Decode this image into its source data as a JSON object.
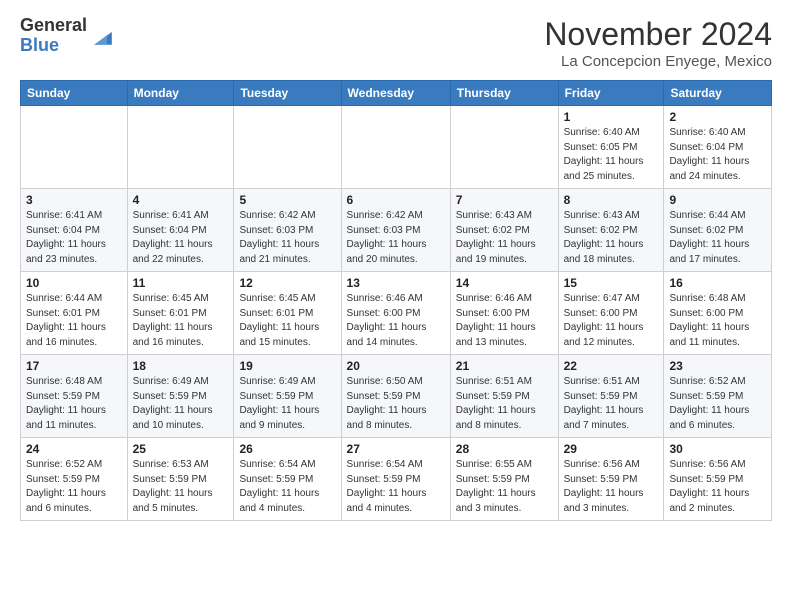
{
  "logo": {
    "general": "General",
    "blue": "Blue"
  },
  "header": {
    "month": "November 2024",
    "location": "La Concepcion Enyege, Mexico"
  },
  "weekdays": [
    "Sunday",
    "Monday",
    "Tuesday",
    "Wednesday",
    "Thursday",
    "Friday",
    "Saturday"
  ],
  "weeks": [
    [
      {
        "day": "",
        "info": ""
      },
      {
        "day": "",
        "info": ""
      },
      {
        "day": "",
        "info": ""
      },
      {
        "day": "",
        "info": ""
      },
      {
        "day": "",
        "info": ""
      },
      {
        "day": "1",
        "info": "Sunrise: 6:40 AM\nSunset: 6:05 PM\nDaylight: 11 hours\nand 25 minutes."
      },
      {
        "day": "2",
        "info": "Sunrise: 6:40 AM\nSunset: 6:04 PM\nDaylight: 11 hours\nand 24 minutes."
      }
    ],
    [
      {
        "day": "3",
        "info": "Sunrise: 6:41 AM\nSunset: 6:04 PM\nDaylight: 11 hours\nand 23 minutes."
      },
      {
        "day": "4",
        "info": "Sunrise: 6:41 AM\nSunset: 6:04 PM\nDaylight: 11 hours\nand 22 minutes."
      },
      {
        "day": "5",
        "info": "Sunrise: 6:42 AM\nSunset: 6:03 PM\nDaylight: 11 hours\nand 21 minutes."
      },
      {
        "day": "6",
        "info": "Sunrise: 6:42 AM\nSunset: 6:03 PM\nDaylight: 11 hours\nand 20 minutes."
      },
      {
        "day": "7",
        "info": "Sunrise: 6:43 AM\nSunset: 6:02 PM\nDaylight: 11 hours\nand 19 minutes."
      },
      {
        "day": "8",
        "info": "Sunrise: 6:43 AM\nSunset: 6:02 PM\nDaylight: 11 hours\nand 18 minutes."
      },
      {
        "day": "9",
        "info": "Sunrise: 6:44 AM\nSunset: 6:02 PM\nDaylight: 11 hours\nand 17 minutes."
      }
    ],
    [
      {
        "day": "10",
        "info": "Sunrise: 6:44 AM\nSunset: 6:01 PM\nDaylight: 11 hours\nand 16 minutes."
      },
      {
        "day": "11",
        "info": "Sunrise: 6:45 AM\nSunset: 6:01 PM\nDaylight: 11 hours\nand 16 minutes."
      },
      {
        "day": "12",
        "info": "Sunrise: 6:45 AM\nSunset: 6:01 PM\nDaylight: 11 hours\nand 15 minutes."
      },
      {
        "day": "13",
        "info": "Sunrise: 6:46 AM\nSunset: 6:00 PM\nDaylight: 11 hours\nand 14 minutes."
      },
      {
        "day": "14",
        "info": "Sunrise: 6:46 AM\nSunset: 6:00 PM\nDaylight: 11 hours\nand 13 minutes."
      },
      {
        "day": "15",
        "info": "Sunrise: 6:47 AM\nSunset: 6:00 PM\nDaylight: 11 hours\nand 12 minutes."
      },
      {
        "day": "16",
        "info": "Sunrise: 6:48 AM\nSunset: 6:00 PM\nDaylight: 11 hours\nand 11 minutes."
      }
    ],
    [
      {
        "day": "17",
        "info": "Sunrise: 6:48 AM\nSunset: 5:59 PM\nDaylight: 11 hours\nand 11 minutes."
      },
      {
        "day": "18",
        "info": "Sunrise: 6:49 AM\nSunset: 5:59 PM\nDaylight: 11 hours\nand 10 minutes."
      },
      {
        "day": "19",
        "info": "Sunrise: 6:49 AM\nSunset: 5:59 PM\nDaylight: 11 hours\nand 9 minutes."
      },
      {
        "day": "20",
        "info": "Sunrise: 6:50 AM\nSunset: 5:59 PM\nDaylight: 11 hours\nand 8 minutes."
      },
      {
        "day": "21",
        "info": "Sunrise: 6:51 AM\nSunset: 5:59 PM\nDaylight: 11 hours\nand 8 minutes."
      },
      {
        "day": "22",
        "info": "Sunrise: 6:51 AM\nSunset: 5:59 PM\nDaylight: 11 hours\nand 7 minutes."
      },
      {
        "day": "23",
        "info": "Sunrise: 6:52 AM\nSunset: 5:59 PM\nDaylight: 11 hours\nand 6 minutes."
      }
    ],
    [
      {
        "day": "24",
        "info": "Sunrise: 6:52 AM\nSunset: 5:59 PM\nDaylight: 11 hours\nand 6 minutes."
      },
      {
        "day": "25",
        "info": "Sunrise: 6:53 AM\nSunset: 5:59 PM\nDaylight: 11 hours\nand 5 minutes."
      },
      {
        "day": "26",
        "info": "Sunrise: 6:54 AM\nSunset: 5:59 PM\nDaylight: 11 hours\nand 4 minutes."
      },
      {
        "day": "27",
        "info": "Sunrise: 6:54 AM\nSunset: 5:59 PM\nDaylight: 11 hours\nand 4 minutes."
      },
      {
        "day": "28",
        "info": "Sunrise: 6:55 AM\nSunset: 5:59 PM\nDaylight: 11 hours\nand 3 minutes."
      },
      {
        "day": "29",
        "info": "Sunrise: 6:56 AM\nSunset: 5:59 PM\nDaylight: 11 hours\nand 3 minutes."
      },
      {
        "day": "30",
        "info": "Sunrise: 6:56 AM\nSunset: 5:59 PM\nDaylight: 11 hours\nand 2 minutes."
      }
    ]
  ]
}
